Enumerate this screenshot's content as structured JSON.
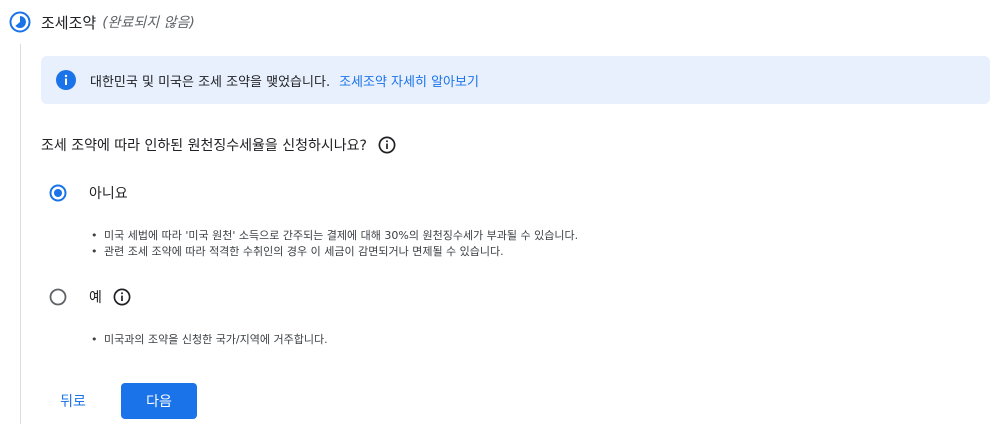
{
  "header": {
    "title": "조세조약",
    "status": "(완료되지 않음)"
  },
  "info": {
    "text": "대한민국 및 미국은 조세 조약을 맺었습니다.",
    "link": "조세조약 자세히 알아보기"
  },
  "question": {
    "text": "조세 조약에 따라 인하된 원천징수세율을 신청하시나요?"
  },
  "options": [
    {
      "label": "아니요",
      "selected": true,
      "bullets": [
        "미국 세법에 따라 '미국 원천' 소득으로 간주되는 결제에 대해 30%의 원천징수세가 부과될 수 있습니다.",
        "관련 조세 조약에 따라 적격한 수취인의 경우 이 세금이 감면되거나 면제될 수 있습니다."
      ]
    },
    {
      "label": "예",
      "selected": false,
      "bullets": [
        "미국과의 조약을 신청한 국가/지역에 거주합니다."
      ]
    }
  ],
  "buttons": {
    "back": "뒤로",
    "next": "다음"
  },
  "colors": {
    "accent": "#1a73e8",
    "info_bg": "#e8f0fe",
    "divider": "#dadce0"
  },
  "icons": {
    "step": "progress-circle-icon",
    "info": "info-filled-icon",
    "help": "info-outline-icon"
  }
}
